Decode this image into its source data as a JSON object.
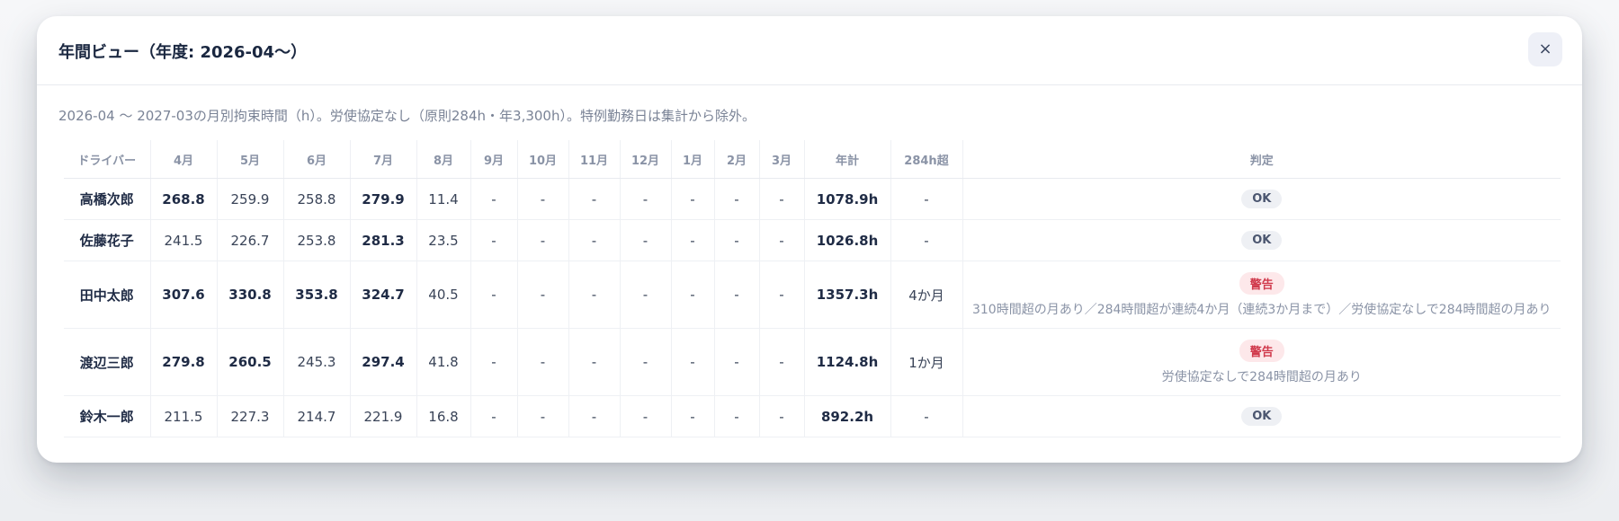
{
  "modal": {
    "title": "年間ビュー（年度: 2026-04〜）",
    "close_label": "×",
    "description": "2026-04 〜 2027-03の月別拘束時間（h）。労使協定なし（原則284h・年3,300h）。特例勤務日は集計から除外。"
  },
  "table": {
    "headers": [
      "ドライバー",
      "4月",
      "5月",
      "6月",
      "7月",
      "8月",
      "9月",
      "10月",
      "11月",
      "12月",
      "1月",
      "2月",
      "3月",
      "年計",
      "284h超",
      "判定"
    ],
    "rows": [
      {
        "name": "高橋次郎",
        "months": [
          "268.8",
          "259.9",
          "258.8",
          "279.9",
          "11.4",
          "-",
          "-",
          "-",
          "-",
          "-",
          "-",
          "-"
        ],
        "total": "1078.9h",
        "over": "-",
        "verdict": "OK",
        "note": ""
      },
      {
        "name": "佐藤花子",
        "months": [
          "241.5",
          "226.7",
          "253.8",
          "281.3",
          "23.5",
          "-",
          "-",
          "-",
          "-",
          "-",
          "-",
          "-"
        ],
        "total": "1026.8h",
        "over": "-",
        "verdict": "OK",
        "note": ""
      },
      {
        "name": "田中太郎",
        "months": [
          "307.6",
          "330.8",
          "353.8",
          "324.7",
          "40.5",
          "-",
          "-",
          "-",
          "-",
          "-",
          "-",
          "-"
        ],
        "total": "1357.3h",
        "over": "4か月",
        "verdict": "警告",
        "note": "310時間超の月あり／284時間超が連続4か月（連続3か月まで）／労使協定なしで284時間超の月あり"
      },
      {
        "name": "渡辺三郎",
        "months": [
          "279.8",
          "260.5",
          "245.3",
          "297.4",
          "41.8",
          "-",
          "-",
          "-",
          "-",
          "-",
          "-",
          "-"
        ],
        "total": "1124.8h",
        "over": "1か月",
        "verdict": "警告",
        "note": "労使協定なしで284時間超の月あり"
      },
      {
        "name": "鈴木一郎",
        "months": [
          "211.5",
          "227.3",
          "214.7",
          "221.9",
          "16.8",
          "-",
          "-",
          "-",
          "-",
          "-",
          "-",
          "-"
        ],
        "total": "892.2h",
        "over": "-",
        "verdict": "OK",
        "note": ""
      }
    ]
  }
}
